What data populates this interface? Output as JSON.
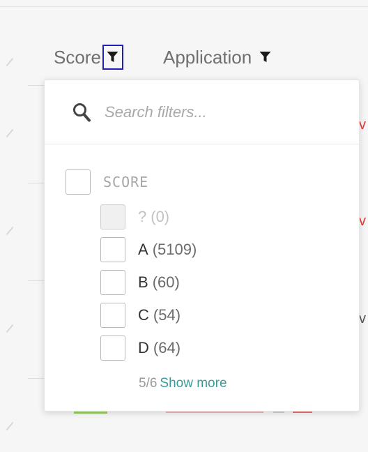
{
  "table": {
    "columns": [
      {
        "label": "Score",
        "filter_active": true
      },
      {
        "label": "Application",
        "filter_active": false
      }
    ],
    "row_edge_letters": [
      "v",
      "v",
      "v"
    ]
  },
  "filter_dropdown": {
    "search": {
      "placeholder": "Search filters...",
      "value": ""
    },
    "group": {
      "label": "SCORE",
      "checked": false
    },
    "options": [
      {
        "label": "?",
        "count": "(0)",
        "checked": false,
        "disabled": true
      },
      {
        "label": "A",
        "count": "(5109)",
        "checked": false,
        "disabled": false
      },
      {
        "label": "B",
        "count": "(60)",
        "checked": false,
        "disabled": false
      },
      {
        "label": "C",
        "count": "(54)",
        "checked": false,
        "disabled": false
      },
      {
        "label": "D",
        "count": "(64)",
        "checked": false,
        "disabled": false
      }
    ],
    "pagination": {
      "shown": "5/6",
      "show_more_label": "Show more"
    }
  },
  "icons": {
    "filter": "funnel-icon",
    "search": "magnifier-icon"
  },
  "colors": {
    "active_filter_outline": "#1f1fb8",
    "link": "#3a9b99",
    "danger_text": "#e53935",
    "good_bar": "#9ccc65"
  }
}
